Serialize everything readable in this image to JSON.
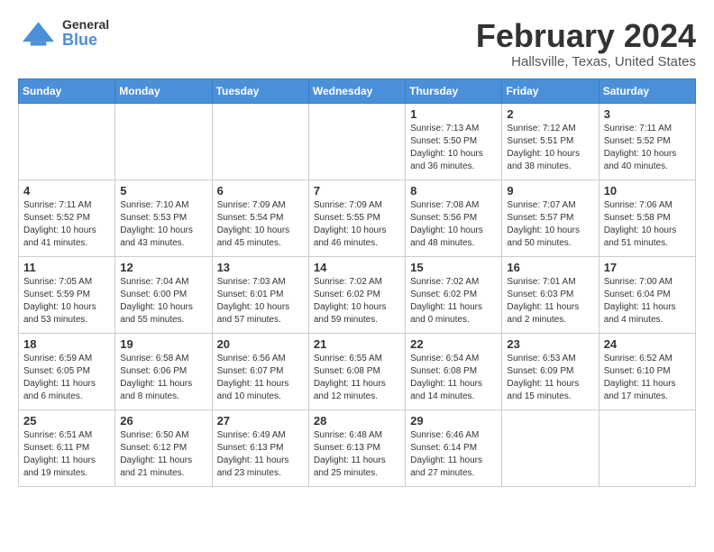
{
  "header": {
    "logo": {
      "general": "General",
      "blue": "Blue"
    },
    "title": "February 2024",
    "location": "Hallsville, Texas, United States"
  },
  "weekdays": [
    "Sunday",
    "Monday",
    "Tuesday",
    "Wednesday",
    "Thursday",
    "Friday",
    "Saturday"
  ],
  "weeks": [
    [
      {
        "day": "",
        "sunrise": "",
        "sunset": "",
        "daylight": ""
      },
      {
        "day": "",
        "sunrise": "",
        "sunset": "",
        "daylight": ""
      },
      {
        "day": "",
        "sunrise": "",
        "sunset": "",
        "daylight": ""
      },
      {
        "day": "",
        "sunrise": "",
        "sunset": "",
        "daylight": ""
      },
      {
        "day": "1",
        "sunrise": "Sunrise: 7:13 AM",
        "sunset": "Sunset: 5:50 PM",
        "daylight": "Daylight: 10 hours and 36 minutes."
      },
      {
        "day": "2",
        "sunrise": "Sunrise: 7:12 AM",
        "sunset": "Sunset: 5:51 PM",
        "daylight": "Daylight: 10 hours and 38 minutes."
      },
      {
        "day": "3",
        "sunrise": "Sunrise: 7:11 AM",
        "sunset": "Sunset: 5:52 PM",
        "daylight": "Daylight: 10 hours and 40 minutes."
      }
    ],
    [
      {
        "day": "4",
        "sunrise": "Sunrise: 7:11 AM",
        "sunset": "Sunset: 5:52 PM",
        "daylight": "Daylight: 10 hours and 41 minutes."
      },
      {
        "day": "5",
        "sunrise": "Sunrise: 7:10 AM",
        "sunset": "Sunset: 5:53 PM",
        "daylight": "Daylight: 10 hours and 43 minutes."
      },
      {
        "day": "6",
        "sunrise": "Sunrise: 7:09 AM",
        "sunset": "Sunset: 5:54 PM",
        "daylight": "Daylight: 10 hours and 45 minutes."
      },
      {
        "day": "7",
        "sunrise": "Sunrise: 7:09 AM",
        "sunset": "Sunset: 5:55 PM",
        "daylight": "Daylight: 10 hours and 46 minutes."
      },
      {
        "day": "8",
        "sunrise": "Sunrise: 7:08 AM",
        "sunset": "Sunset: 5:56 PM",
        "daylight": "Daylight: 10 hours and 48 minutes."
      },
      {
        "day": "9",
        "sunrise": "Sunrise: 7:07 AM",
        "sunset": "Sunset: 5:57 PM",
        "daylight": "Daylight: 10 hours and 50 minutes."
      },
      {
        "day": "10",
        "sunrise": "Sunrise: 7:06 AM",
        "sunset": "Sunset: 5:58 PM",
        "daylight": "Daylight: 10 hours and 51 minutes."
      }
    ],
    [
      {
        "day": "11",
        "sunrise": "Sunrise: 7:05 AM",
        "sunset": "Sunset: 5:59 PM",
        "daylight": "Daylight: 10 hours and 53 minutes."
      },
      {
        "day": "12",
        "sunrise": "Sunrise: 7:04 AM",
        "sunset": "Sunset: 6:00 PM",
        "daylight": "Daylight: 10 hours and 55 minutes."
      },
      {
        "day": "13",
        "sunrise": "Sunrise: 7:03 AM",
        "sunset": "Sunset: 6:01 PM",
        "daylight": "Daylight: 10 hours and 57 minutes."
      },
      {
        "day": "14",
        "sunrise": "Sunrise: 7:02 AM",
        "sunset": "Sunset: 6:02 PM",
        "daylight": "Daylight: 10 hours and 59 minutes."
      },
      {
        "day": "15",
        "sunrise": "Sunrise: 7:02 AM",
        "sunset": "Sunset: 6:02 PM",
        "daylight": "Daylight: 11 hours and 0 minutes."
      },
      {
        "day": "16",
        "sunrise": "Sunrise: 7:01 AM",
        "sunset": "Sunset: 6:03 PM",
        "daylight": "Daylight: 11 hours and 2 minutes."
      },
      {
        "day": "17",
        "sunrise": "Sunrise: 7:00 AM",
        "sunset": "Sunset: 6:04 PM",
        "daylight": "Daylight: 11 hours and 4 minutes."
      }
    ],
    [
      {
        "day": "18",
        "sunrise": "Sunrise: 6:59 AM",
        "sunset": "Sunset: 6:05 PM",
        "daylight": "Daylight: 11 hours and 6 minutes."
      },
      {
        "day": "19",
        "sunrise": "Sunrise: 6:58 AM",
        "sunset": "Sunset: 6:06 PM",
        "daylight": "Daylight: 11 hours and 8 minutes."
      },
      {
        "day": "20",
        "sunrise": "Sunrise: 6:56 AM",
        "sunset": "Sunset: 6:07 PM",
        "daylight": "Daylight: 11 hours and 10 minutes."
      },
      {
        "day": "21",
        "sunrise": "Sunrise: 6:55 AM",
        "sunset": "Sunset: 6:08 PM",
        "daylight": "Daylight: 11 hours and 12 minutes."
      },
      {
        "day": "22",
        "sunrise": "Sunrise: 6:54 AM",
        "sunset": "Sunset: 6:08 PM",
        "daylight": "Daylight: 11 hours and 14 minutes."
      },
      {
        "day": "23",
        "sunrise": "Sunrise: 6:53 AM",
        "sunset": "Sunset: 6:09 PM",
        "daylight": "Daylight: 11 hours and 15 minutes."
      },
      {
        "day": "24",
        "sunrise": "Sunrise: 6:52 AM",
        "sunset": "Sunset: 6:10 PM",
        "daylight": "Daylight: 11 hours and 17 minutes."
      }
    ],
    [
      {
        "day": "25",
        "sunrise": "Sunrise: 6:51 AM",
        "sunset": "Sunset: 6:11 PM",
        "daylight": "Daylight: 11 hours and 19 minutes."
      },
      {
        "day": "26",
        "sunrise": "Sunrise: 6:50 AM",
        "sunset": "Sunset: 6:12 PM",
        "daylight": "Daylight: 11 hours and 21 minutes."
      },
      {
        "day": "27",
        "sunrise": "Sunrise: 6:49 AM",
        "sunset": "Sunset: 6:13 PM",
        "daylight": "Daylight: 11 hours and 23 minutes."
      },
      {
        "day": "28",
        "sunrise": "Sunrise: 6:48 AM",
        "sunset": "Sunset: 6:13 PM",
        "daylight": "Daylight: 11 hours and 25 minutes."
      },
      {
        "day": "29",
        "sunrise": "Sunrise: 6:46 AM",
        "sunset": "Sunset: 6:14 PM",
        "daylight": "Daylight: 11 hours and 27 minutes."
      },
      {
        "day": "",
        "sunrise": "",
        "sunset": "",
        "daylight": ""
      },
      {
        "day": "",
        "sunrise": "",
        "sunset": "",
        "daylight": ""
      }
    ]
  ]
}
